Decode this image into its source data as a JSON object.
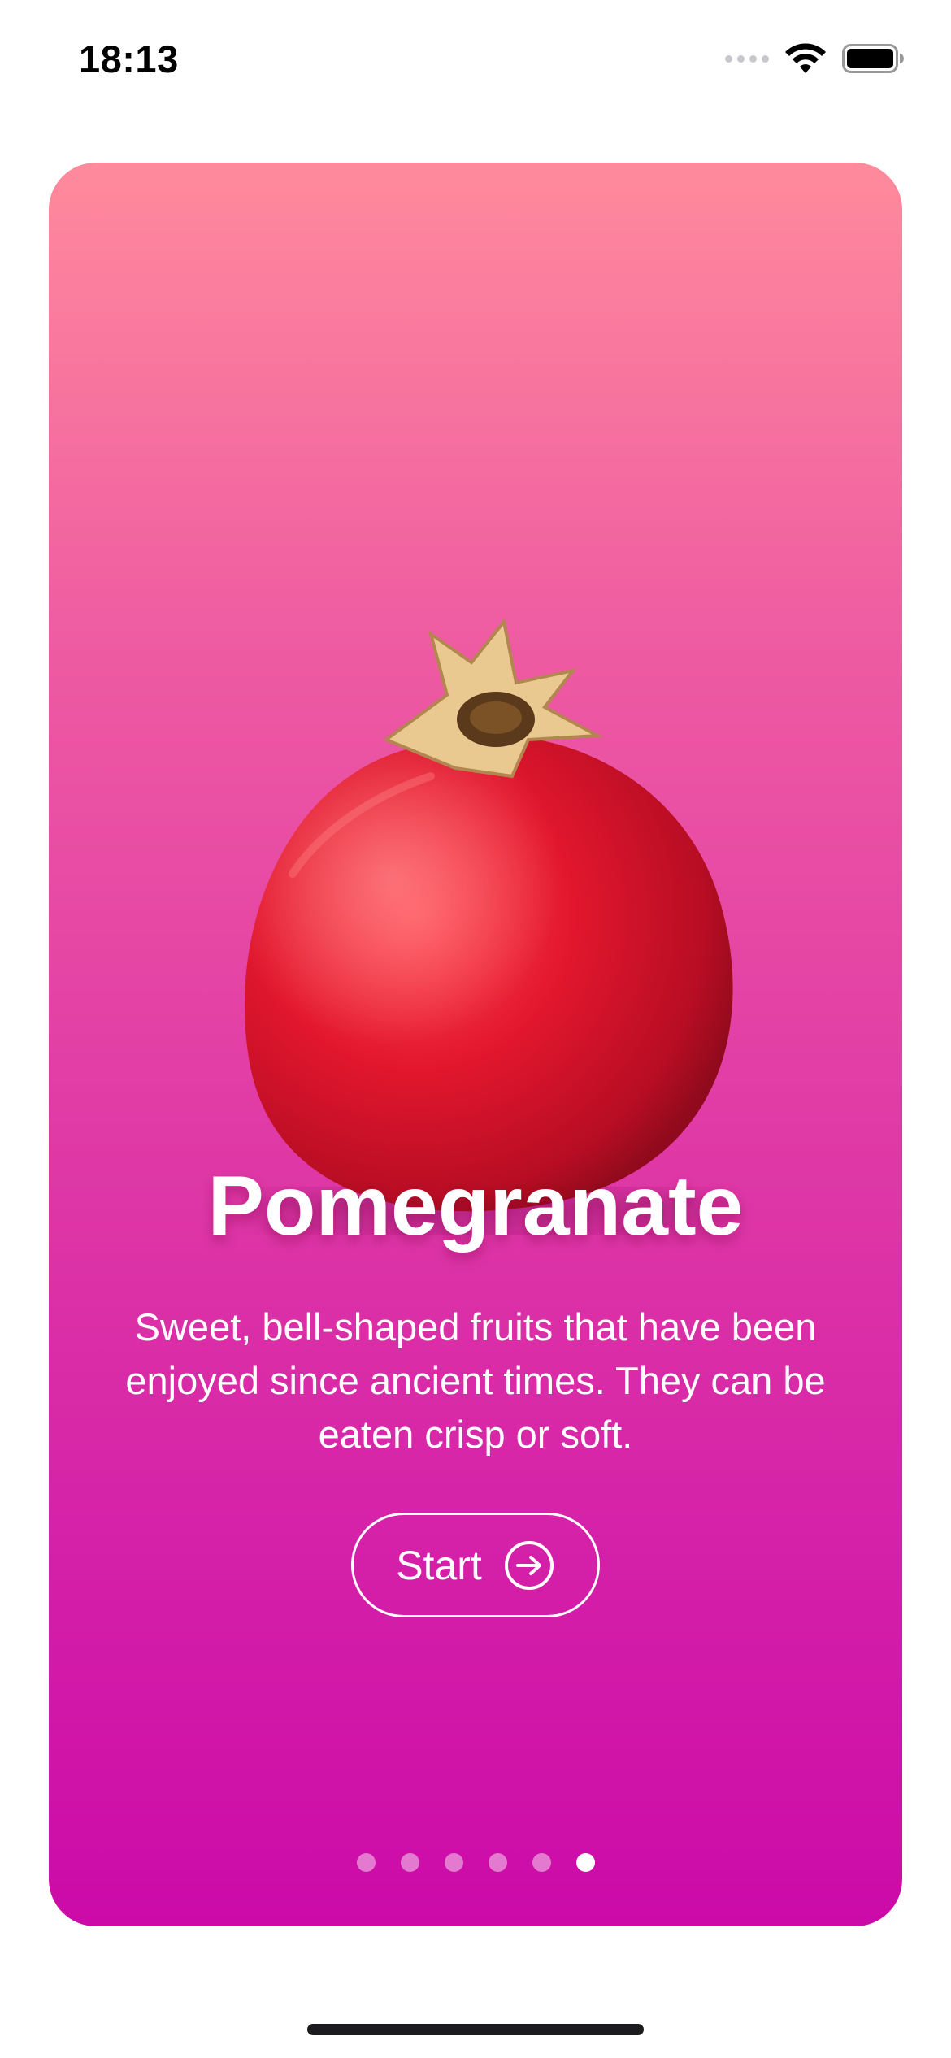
{
  "status_bar": {
    "time": "18:13",
    "icons": [
      "cellular-signal-icon",
      "wifi-icon",
      "battery-icon"
    ]
  },
  "card": {
    "title": "Pomegranate",
    "description": "Sweet, bell-shaped fruits that have been enjoyed since ancient times. They can be eaten crisp or soft.",
    "start_label": "Start",
    "start_icon": "arrow-right-circle-icon",
    "image": "pomegranate-image",
    "pagination": {
      "total": 6,
      "active_index": 5
    },
    "colors": {
      "gradient_top": "#ff8a9c",
      "gradient_bottom": "#cc0aa8",
      "text": "#ffffff"
    }
  }
}
